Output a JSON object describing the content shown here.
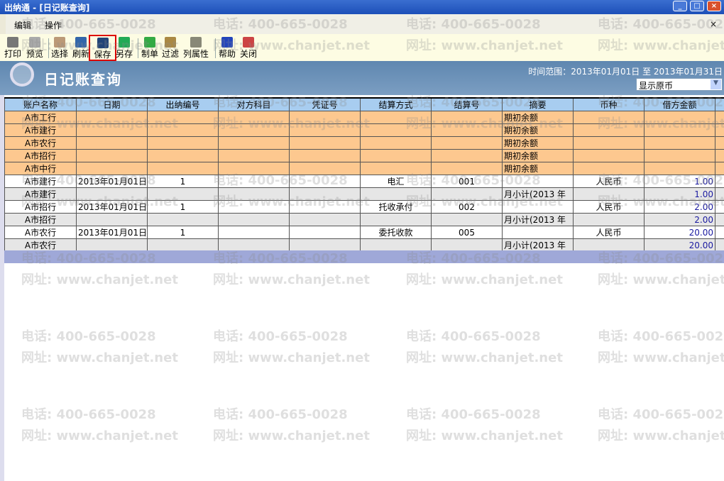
{
  "window": {
    "title": "出纳通 - [日记账查询]",
    "min": "_",
    "max": "□",
    "close": "×"
  },
  "menu": {
    "items": [
      "编辑",
      "操作"
    ],
    "close": "×"
  },
  "toolbar": [
    {
      "label": "打印",
      "icon": "printer-icon",
      "color": "#777"
    },
    {
      "label": "预览",
      "icon": "preview-icon",
      "color": "#aaa"
    },
    {
      "label": "选择",
      "icon": "select-icon",
      "color": "#b97"
    },
    {
      "label": "刷新",
      "icon": "refresh-icon",
      "color": "#36a"
    },
    {
      "label": "保存",
      "icon": "save-icon",
      "color": "#247"
    },
    {
      "label": "另存",
      "icon": "save-as-icon",
      "color": "#2a5"
    },
    {
      "label": "制单",
      "icon": "voucher-icon",
      "color": "#3a4"
    },
    {
      "label": "过滤",
      "icon": "filter-icon",
      "color": "#a84"
    },
    {
      "label": "列属性",
      "icon": "column-props-icon",
      "color": "#887"
    },
    {
      "label": "帮助",
      "icon": "help-icon",
      "color": "#24b"
    },
    {
      "label": "关闭",
      "icon": "close-window-icon",
      "color": "#c44"
    }
  ],
  "banner": {
    "title": "日记账查询",
    "range": "时间范围：2013年01月01日 至 2013年01月31日",
    "currency": "显示原币"
  },
  "watermark": {
    "phone": "电话: 400-665-0028",
    "site": "网址: www.chanjet.net"
  },
  "table": {
    "columns": [
      "账户名称",
      "日期",
      "出纳编号",
      "对方科目",
      "凭证号",
      "结算方式",
      "结算号",
      "摘要",
      "币种",
      "借方金额",
      ""
    ],
    "rows": [
      {
        "type": "ob",
        "cells": [
          "A市工行",
          "",
          "",
          "",
          "",
          "",
          "",
          "期初余额",
          "",
          "",
          ""
        ]
      },
      {
        "type": "ob",
        "cells": [
          "A市建行",
          "",
          "",
          "",
          "",
          "",
          "",
          "期初余额",
          "",
          "",
          ""
        ]
      },
      {
        "type": "ob",
        "cells": [
          "A市农行",
          "",
          "",
          "",
          "",
          "",
          "",
          "期初余额",
          "",
          "",
          ""
        ]
      },
      {
        "type": "ob",
        "cells": [
          "A市招行",
          "",
          "",
          "",
          "",
          "",
          "",
          "期初余额",
          "",
          "",
          ""
        ]
      },
      {
        "type": "ob",
        "cells": [
          "A市中行",
          "",
          "",
          "",
          "",
          "",
          "",
          "期初余额",
          "",
          "",
          ""
        ]
      },
      {
        "type": "dt",
        "cells": [
          "A市建行",
          "2013年01月01日",
          "1",
          "",
          "",
          "电汇",
          "001",
          "",
          "人民币",
          "1.00",
          ""
        ]
      },
      {
        "type": "st",
        "cells": [
          "A市建行",
          "",
          "",
          "",
          "",
          "",
          "",
          "月小计(2013 年",
          "",
          "1.00",
          ""
        ]
      },
      {
        "type": "dt",
        "cells": [
          "A市招行",
          "2013年01月01日",
          "1",
          "",
          "",
          "托收承付",
          "002",
          "",
          "人民币",
          "2.00",
          ""
        ]
      },
      {
        "type": "st",
        "cells": [
          "A市招行",
          "",
          "",
          "",
          "",
          "",
          "",
          "月小计(2013 年",
          "",
          "2.00",
          ""
        ]
      },
      {
        "type": "dt",
        "cells": [
          "A市农行",
          "2013年01月01日",
          "1",
          "",
          "",
          "委托收款",
          "005",
          "",
          "人民币",
          "20.00",
          ""
        ]
      },
      {
        "type": "st",
        "cells": [
          "A市农行",
          "",
          "",
          "",
          "",
          "",
          "",
          "月小计(2013 年",
          "",
          "20.00",
          ""
        ]
      }
    ]
  }
}
